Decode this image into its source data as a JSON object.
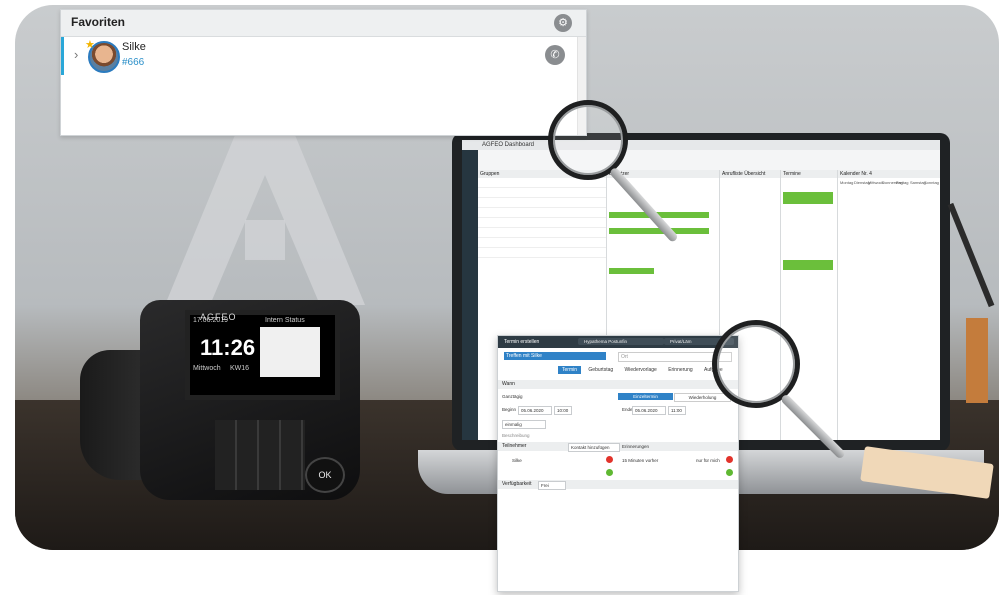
{
  "favoriten": {
    "title": "Favoriten",
    "contact": {
      "name": "Silke",
      "number": "#666"
    }
  },
  "phone": {
    "brand": "AGFEO",
    "time": "11:26",
    "date": "17.06.2019",
    "weekday": "Mittwoch",
    "week": "KW16",
    "status": "Intern Status",
    "ok_label": "OK"
  },
  "laptop": {
    "window_title": "AGFEO Dashboard",
    "columns": [
      "Gruppen",
      "Benutzer",
      "Anrufliste Übersicht",
      "Termine",
      "Kalender Nr. 4"
    ],
    "calendar_days": [
      "Montag",
      "Dienstag",
      "Mittwoch",
      "Donnerstag",
      "Freitag",
      "Samstag",
      "Sonntag"
    ]
  },
  "dialog": {
    "header": "Termin erstellen",
    "calendar_pick": "Hypathema Postunfin",
    "privacy_pick": "Privat/Läm",
    "subject": "Treffen mit Silke",
    "location": "Ort",
    "tabs": [
      "Termin",
      "Geburtstag",
      "Wiedervorlage",
      "Erinnerung",
      "Aufgabe"
    ],
    "when_section": "Wann",
    "allday_label": "Ganztägig",
    "mode_single": "Einzeltermin",
    "mode_repeat": "Wiederholung",
    "begin_label": "Beginn",
    "begin_date": "05.06.2020",
    "begin_time": "10:00",
    "end_label": "Ende",
    "end_date": "05.06.2020",
    "end_time": "11:00",
    "recurrence": "einmalig",
    "description_label": "Beschreibung",
    "participants_label": "Teilnehmer",
    "add_contact_btn": "Kontakt hinzufügen",
    "reminder_label": "Erinnerungen",
    "participant": "Silke",
    "reminder_value": "15 Minuten vorher",
    "reminder_mode": "nur für mich",
    "status_label": "Verfügbarkeit",
    "status_value": "Frei"
  },
  "colors": {
    "accent": "#2f82c7",
    "green": "#6bbf3b",
    "red": "#e2332b",
    "sidebar": "#263640"
  },
  "icons": [
    "gear-icon",
    "phone-icon",
    "star-icon",
    "chevron-right-icon",
    "magnifier-icon"
  ]
}
